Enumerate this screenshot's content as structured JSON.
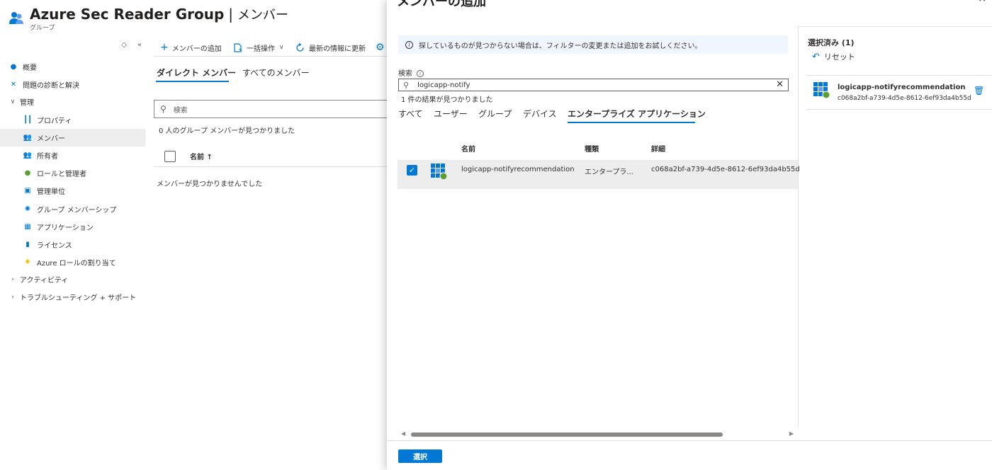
{
  "header": {
    "title": "Azure Sec Reader Group",
    "separator": "|",
    "page": "メンバー",
    "more": "···",
    "subtitle": "グループ"
  },
  "sidebar": {
    "collapse_up": "◇",
    "collapse_left": "«",
    "items": [
      {
        "label": "概要",
        "icon": "info-icon",
        "color": "#0078d4"
      },
      {
        "label": "問題の診断と解決",
        "icon": "wrench-icon",
        "color": "#0078d4"
      },
      {
        "label": "管理",
        "icon": "chevron-down-icon",
        "expanded": true
      },
      {
        "label": "プロパティ",
        "icon": "properties-icon",
        "color": "#0078d4"
      },
      {
        "label": "メンバー",
        "icon": "members-icon",
        "color": "#0078d4",
        "selected": true
      },
      {
        "label": "所有者",
        "icon": "owners-icon",
        "color": "#0078d4"
      },
      {
        "label": "ロールと管理者",
        "icon": "roles-icon",
        "color": "#5c9e31"
      },
      {
        "label": "管理単位",
        "icon": "admin-units-icon",
        "color": "#0078d4"
      },
      {
        "label": "グループ メンバーシップ",
        "icon": "gear-icon",
        "color": "#0078d4"
      },
      {
        "label": "アプリケーション",
        "icon": "apps-icon",
        "color": "#0078d4"
      },
      {
        "label": "ライセンス",
        "icon": "license-icon",
        "color": "#0078d4"
      },
      {
        "label": "Azure ロールの割り当て",
        "icon": "key-icon",
        "color": "#ffb900"
      },
      {
        "label": "アクティビティ",
        "icon": "chevron-right-icon"
      },
      {
        "label": "トラブルシューティング + サポート",
        "icon": "chevron-right-icon"
      }
    ]
  },
  "toolbar": {
    "add_member": "メンバーの追加",
    "bulk": "一括操作",
    "refresh": "最新の情報に更新"
  },
  "member_tabs": {
    "direct": "ダイレクト メンバー",
    "all": "すべてのメンバー"
  },
  "member_search": {
    "placeholder": "検索"
  },
  "member_count_text": "0 人のグループ メンバーが見つかりました",
  "member_table": {
    "col_name": "名前 ↑"
  },
  "member_empty": "メンバーが見つかりませんでした",
  "panel": {
    "title": "メンバーの追加",
    "close": "×",
    "info": "探しているものが見つからない場合は、フィルターの変更または追加をお試しください。",
    "search_label": "検索",
    "search_value": "logicapp-notify",
    "result_count": "1 件の結果が見つかりました",
    "tabs": [
      "すべて",
      "ユーザー",
      "グループ",
      "デバイス",
      "エンタープライズ アプリケーション"
    ],
    "columns": {
      "name": "名前",
      "type": "種類",
      "details": "詳細"
    },
    "rows": [
      {
        "name": "logicapp-notifyrecommendation",
        "type": "エンタープラ...",
        "details": "c068a2bf-a739-4d5e-8612-6ef93da4b55d",
        "checked": true
      }
    ],
    "select_button": "選択"
  },
  "selected": {
    "title": "選択済み (1)",
    "reset": "リセット",
    "items": [
      {
        "name": "logicapp-notifyrecommendation",
        "id": "c068a2bf-a739-4d5e-8612-6ef93da4b55d"
      }
    ]
  },
  "colors": {
    "accent": "#0078d4",
    "selected_bg": "#ededed",
    "info_bg": "#f0f6ff"
  }
}
